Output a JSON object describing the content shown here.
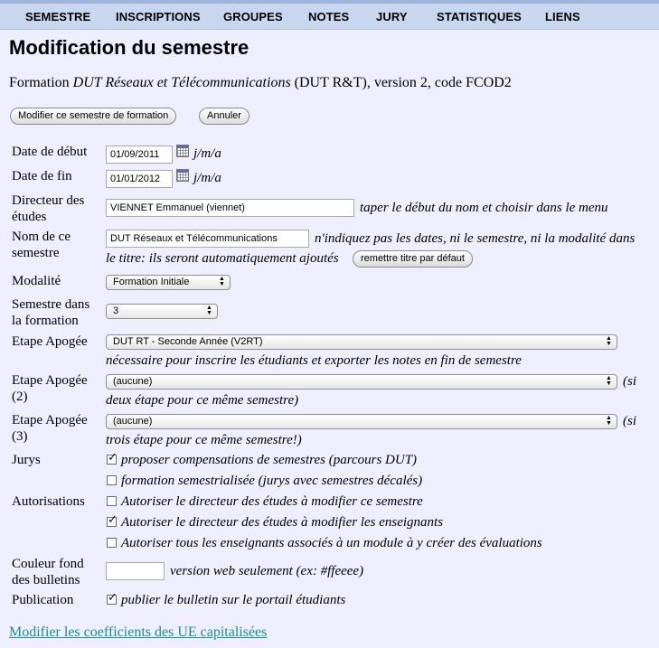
{
  "menu": [
    "SEMESTRE",
    "INSCRIPTIONS",
    "GROUPES",
    "NOTES",
    "JURY",
    "STATISTIQUES",
    "LIENS"
  ],
  "title": "Modification du semestre",
  "formation": {
    "prefix": "Formation ",
    "name": "DUT Réseaux et Télécommunications",
    "suffix": " (DUT R&T), version 2, code FCOD2"
  },
  "buttons": {
    "modify": "Modifier ce semestre de formation",
    "cancel": "Annuler",
    "reset_title": "remettre titre par défaut"
  },
  "fields": {
    "date_debut": {
      "label": "Date de début",
      "value": "01/09/2011",
      "hint": "j/m/a"
    },
    "date_fin": {
      "label": "Date de fin",
      "value": "01/01/2012",
      "hint": "j/m/a"
    },
    "directeur": {
      "label1": "Directeur des",
      "label2": "études",
      "value": "VIENNET Emmanuel (viennet)",
      "hint": "taper le début du nom et choisir dans le menu"
    },
    "nom": {
      "label1": "Nom de ce",
      "label2": "semestre",
      "value": "DUT Réseaux et Télécommunications",
      "hint1": "n'indiquez pas les dates, ni le semestre, ni la modalité dans",
      "hint2": "le titre: ils seront automatiquement ajoutés"
    },
    "modalite": {
      "label": "Modalité",
      "value": "Formation Initiale"
    },
    "semestre": {
      "label1": "Semestre dans",
      "label2": "la formation",
      "value": "3"
    },
    "etape1": {
      "label": "Etape Apogée",
      "value": "DUT RT - Seconde Année (V2RT)",
      "hint": "nécessaire pour inscrire les étudiants et exporter les notes en fin de semestre"
    },
    "etape2": {
      "label1": "Etape Apogée",
      "label2": "(2)",
      "value": "(aucune)",
      "hint1": "(si",
      "hint2": "deux étape pour ce même semestre)"
    },
    "etape3": {
      "label1": "Etape Apogée",
      "label2": "(3)",
      "value": "(aucune)",
      "hint1": "(si",
      "hint2": "trois étape pour ce même semestre!)"
    },
    "jurys": {
      "label": "Jurys",
      "opt1": "proposer compensations de semestres (parcours DUT)",
      "opt1_checked": true,
      "opt2": "formation semestrialisée (jurys avec semestres décalés)",
      "opt2_checked": false
    },
    "autorisations": {
      "label": "Autorisations",
      "opt1": "Autoriser le directeur des études à modifier ce semestre",
      "opt1_checked": false,
      "opt2": "Autoriser le directeur des études à modifier les enseignants",
      "opt2_checked": true,
      "opt3": "Autoriser tous les enseignants associés à un module à y créer des évaluations",
      "opt3_checked": false
    },
    "couleur": {
      "label1": "Couleur fond",
      "label2": "des bulletins",
      "value": "",
      "hint": "version web seulement (ex: #ffeeee)"
    },
    "publication": {
      "label": "Publication",
      "opt": "publier le bulletin sur le portail étudiants",
      "opt_checked": true
    }
  },
  "link": "Modifier les coefficients des UE capitalisées",
  "colors": {
    "background": "#eeeefe",
    "menubar": "#c8d7ef",
    "link": "#1d8e8e"
  }
}
